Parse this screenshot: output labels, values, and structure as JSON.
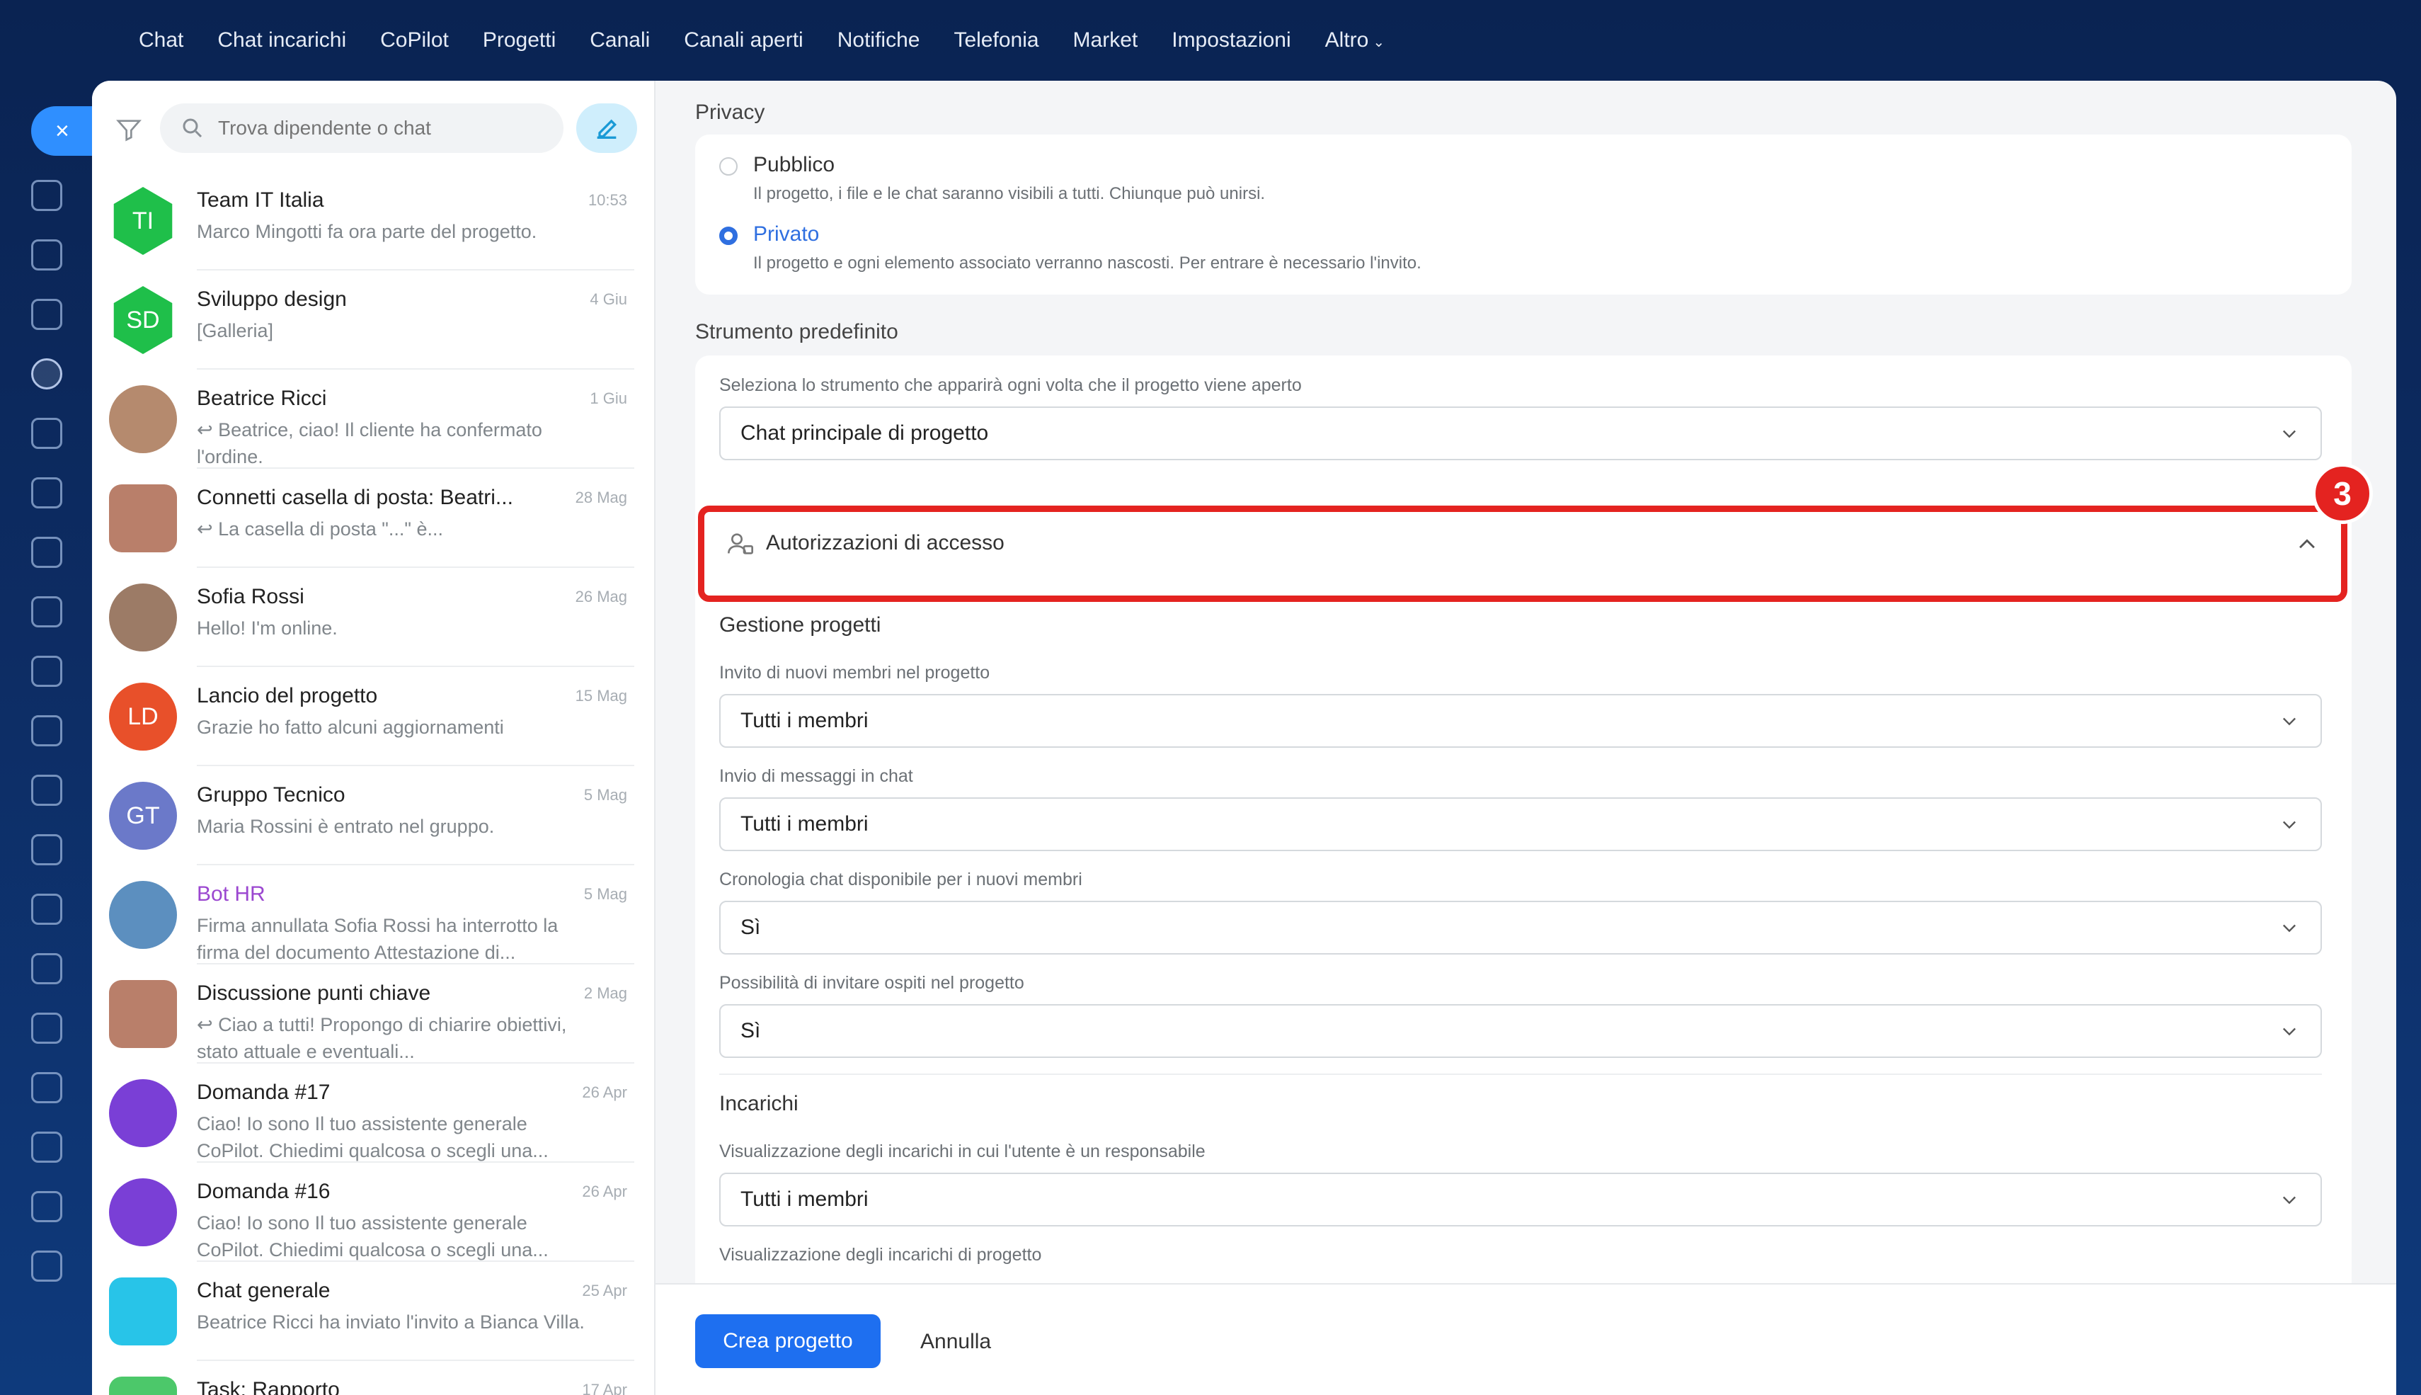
{
  "topnav": {
    "items": [
      "Chat",
      "Chat incarichi",
      "CoPilot",
      "Progetti",
      "Canali",
      "Canali aperti",
      "Notifiche",
      "Telefonia",
      "Market",
      "Impostazioni",
      "Altro"
    ]
  },
  "rail": {
    "close_glyph": "×",
    "icons": [
      "chat-icon",
      "tasks-icon",
      "copilot-icon",
      "projects-icon",
      "feed-icon",
      "calendar-icon",
      "documents-icon",
      "boards-icon",
      "drive-icon",
      "mail-icon",
      "crm-icon",
      "shop-icon",
      "inventory-icon",
      "sites-icon",
      "knowledge-icon",
      "timeman-icon",
      "reports-icon",
      "sign-icon",
      "edit-icon"
    ]
  },
  "search": {
    "placeholder": "Trova dipendente o chat"
  },
  "chats": [
    {
      "name": "Team IT Italia",
      "time": "10:53",
      "preview": "Marco Mingotti fa ora parte del progetto.",
      "avatar_text": "TI",
      "avatar_color": "#1fbf4a"
    },
    {
      "name": "Sviluppo design",
      "time": "4 Giu",
      "preview": "[Galleria]",
      "avatar_text": "SD",
      "avatar_color": "#1fbf4a"
    },
    {
      "name": "Beatrice Ricci",
      "time": "1 Giu",
      "preview": "↩ Beatrice, ciao! Il cliente ha confermato l'ordine.",
      "avatar_text": "",
      "avatar_color": "#b58a6e"
    },
    {
      "name": "Connetti casella di posta: Beatri...",
      "time": "28 Mag",
      "preview": "↩ La casella di posta \"...\" è...",
      "avatar_text": "",
      "avatar_color": "#b97f6a"
    },
    {
      "name": "Sofia Rossi",
      "time": "26 Mag",
      "preview": "Hello! I'm online.",
      "avatar_text": "",
      "avatar_color": "#9c7b66"
    },
    {
      "name": "Lancio del progetto",
      "time": "15 Mag",
      "preview": "Grazie ho fatto alcuni aggiornamenti",
      "avatar_text": "LD",
      "avatar_color": "#e8502a"
    },
    {
      "name": "Gruppo Tecnico",
      "time": "5 Mag",
      "preview": "Maria Rossini è entrato nel gruppo.",
      "avatar_text": "GT",
      "avatar_color": "#6b79c9"
    },
    {
      "name": "Bot HR",
      "time": "5 Mag",
      "preview": "Firma annullata Sofia Rossi ha interrotto la firma del documento Attestazione di...",
      "avatar_text": "",
      "avatar_color": "#5c8fbf"
    },
    {
      "name": "Discussione punti chiave",
      "time": "2 Mag",
      "preview": "↩ Ciao a tutti! Propongo di chiarire obiettivi, stato attuale e eventuali...",
      "avatar_text": "",
      "avatar_color": "#b97f6a"
    },
    {
      "name": "Domanda #17",
      "time": "26 Apr",
      "preview": "Ciao! Io sono Il tuo assistente generale CoPilot. Chiedimi qualcosa o scegli una...",
      "avatar_text": "",
      "avatar_color": "#7a3fd6"
    },
    {
      "name": "Domanda #16",
      "time": "26 Apr",
      "preview": "Ciao! Io sono Il tuo assistente generale CoPilot. Chiedimi qualcosa o scegli una...",
      "avatar_text": "",
      "avatar_color": "#7a3fd6"
    },
    {
      "name": "Chat generale",
      "time": "25 Apr",
      "preview": "Beatrice Ricci ha inviato l'invito a Bianca Villa.",
      "avatar_text": "",
      "avatar_color": "#28c4e8"
    },
    {
      "name": "Task: Rapporto",
      "time": "17 Apr",
      "preview": "",
      "avatar_text": "",
      "avatar_color": "#4cc86a"
    }
  ],
  "form": {
    "privacy_title": "Privacy",
    "public_label": "Pubblico",
    "public_desc": "Il progetto, i file e le chat saranno visibili a tutti. Chiunque può unirsi.",
    "private_label": "Privato",
    "private_desc": "Il progetto e ogni elemento associato verranno nascosti. Per entrare è necessario l'invito.",
    "privacy_selected": "Privato",
    "tool_title": "Strumento predefinito",
    "tool_hint": "Seleziona lo strumento che apparirà ogni volta che il progetto viene aperto",
    "tool_value": "Chat principale di progetto",
    "access_title": "Autorizzazioni di accesso",
    "step_number": "3",
    "projects_subhead": "Gestione progetti",
    "invite_label": "Invito di nuovi membri nel progetto",
    "invite_value": "Tutti i membri",
    "messages_label": "Invio di messaggi in chat",
    "messages_value": "Tutti i membri",
    "history_label": "Cronologia chat disponibile per i nuovi membri",
    "history_value": "Sì",
    "guests_label": "Possibilità di invitare ospiti nel progetto",
    "guests_value": "Sì",
    "tasks_subhead": "Incarichi",
    "tasks_resp_label": "Visualizzazione degli incarichi in cui l'utente è un responsabile",
    "tasks_resp_value": "Tutti i membri",
    "tasks_proj_label": "Visualizzazione degli incarichi di progetto"
  },
  "footer": {
    "create_label": "Crea progetto",
    "cancel_label": "Annulla"
  },
  "colors": {
    "accent": "#2f6fe0",
    "highlight": "#e42320",
    "primary_button": "#1e6ff0"
  }
}
